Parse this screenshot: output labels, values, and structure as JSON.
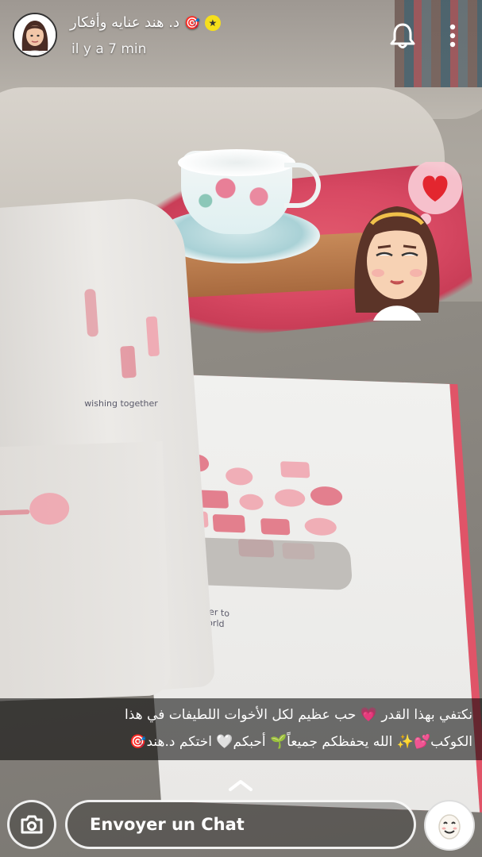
{
  "story": {
    "username": "د. هند عنايه وأفكار",
    "timestamp": "il y a 7 min",
    "badge_icon": "star-badge-icon",
    "emoji_after_name": "🎯"
  },
  "header": {
    "notification_icon": "bell-icon",
    "more_icon": "more-vertical-icon"
  },
  "book_page": {
    "handwriting_top": "wishing together",
    "handwriting_bottom": [
      "joining together to",
      "change the world"
    ]
  },
  "caption": {
    "line1": "نكتفي بهذا القدر 💗 حب عظيم لكل الأخوات اللطيفات في هذا",
    "line2": "الكوكب💕✨ الله  يحفظكم جميعاً🌱 أحبكم🤍 اختكم د.هند🎯"
  },
  "footer": {
    "chat_placeholder": "Envoyer un Chat",
    "camera_icon": "camera-icon",
    "bitmoji_icon": "bitmoji-icon",
    "expand_icon": "chevron-up-icon"
  },
  "colors": {
    "badge_yellow": "#f6df1b",
    "caption_bg": "rgba(0,0,0,0.55)",
    "heart_red": "#e3262f"
  }
}
